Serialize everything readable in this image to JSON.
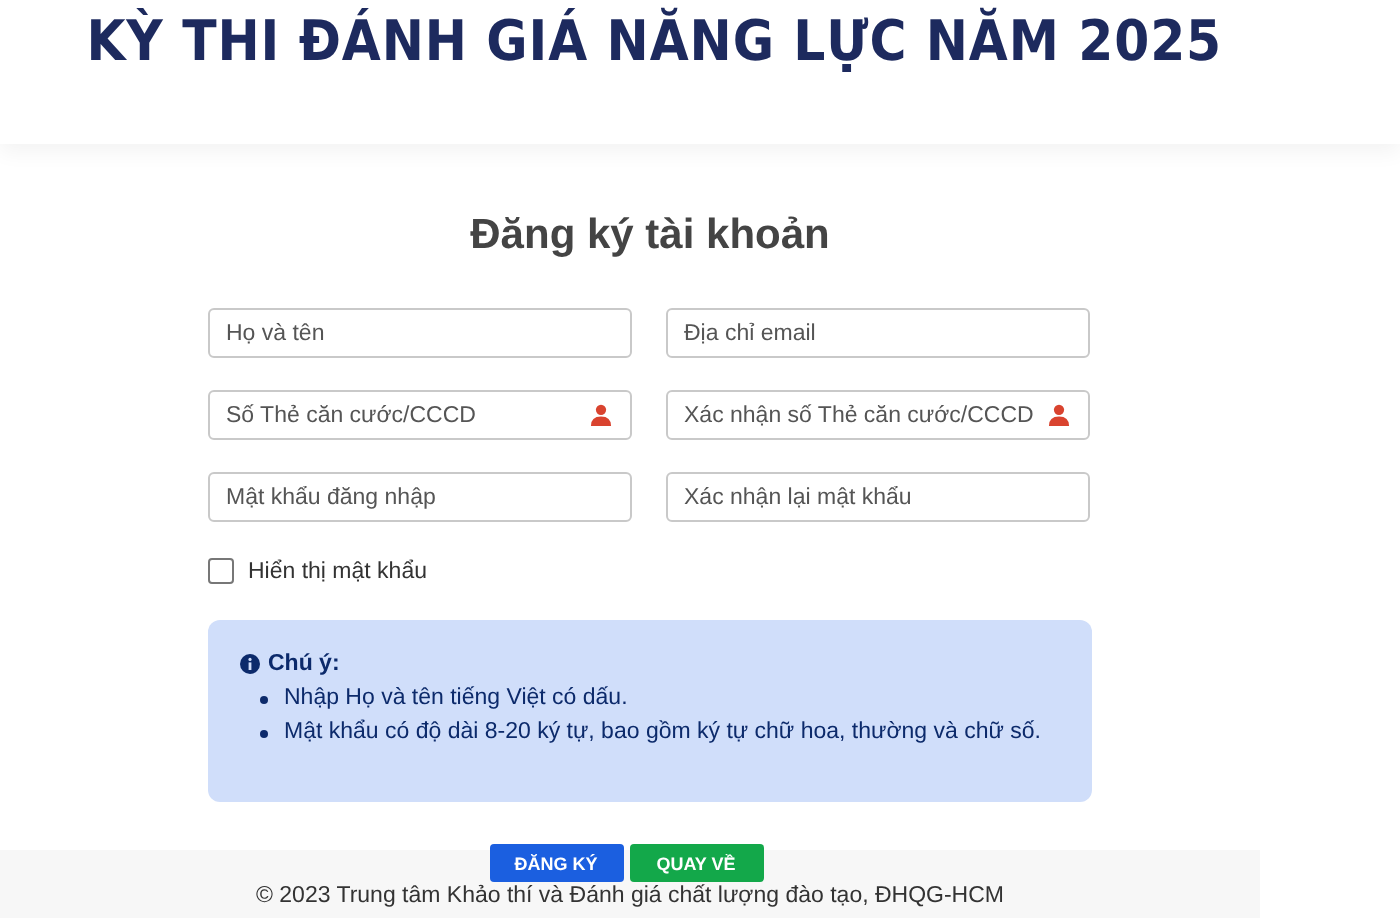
{
  "header": {
    "title": "KỲ THI ĐÁNH GIÁ NĂNG LỰC NĂM 2025"
  },
  "form": {
    "title": "Đăng ký tài khoản",
    "fields": [
      {
        "placeholder": "Họ và tên",
        "kind": "text"
      },
      {
        "placeholder": "Địa chỉ email",
        "kind": "text"
      },
      {
        "placeholder": "Số Thẻ căn cước/CCCD",
        "kind": "id"
      },
      {
        "placeholder": "Xác nhận số Thẻ căn cước/CCCD",
        "kind": "id"
      },
      {
        "placeholder": "Mật khẩu đăng nhập",
        "kind": "password"
      },
      {
        "placeholder": "Xác nhận lại mật khẩu",
        "kind": "password"
      }
    ],
    "show_password": {
      "label": "Hiển thị mật khẩu",
      "checked": false
    },
    "note": {
      "title": "Chú ý:",
      "items": [
        "Nhập Họ và tên tiếng Việt có dấu.",
        "Mật khẩu có độ dài 8-20 ký tự, bao gồm ký tự chữ hoa, thường và chữ số."
      ]
    },
    "buttons": [
      {
        "label": "ĐĂNG KÝ",
        "kind": "primary"
      },
      {
        "label": "QUAY VỀ",
        "kind": "back"
      }
    ]
  },
  "footer": {
    "text": "© 2023 Trung tâm Khảo thí và Đánh giá chất lượng đào tạo, ĐHQG-HCM"
  }
}
